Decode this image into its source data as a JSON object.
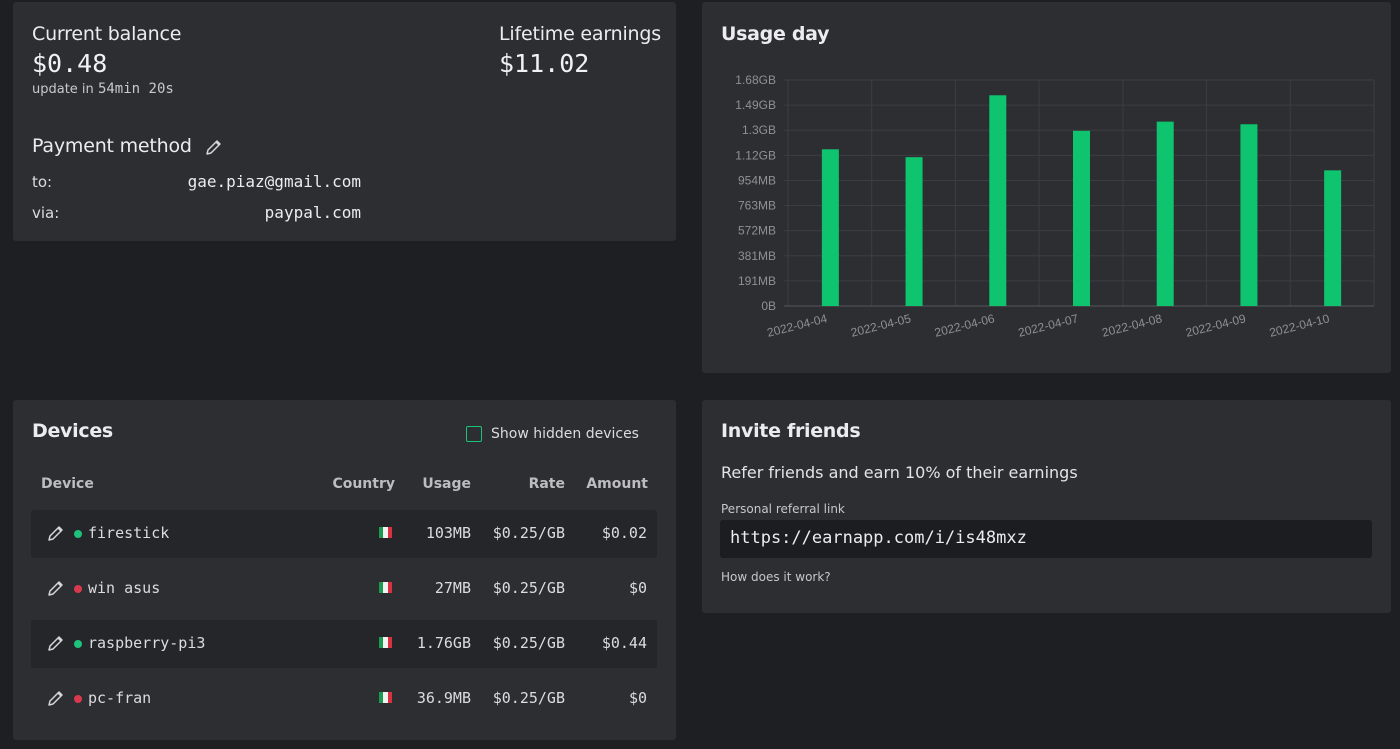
{
  "balance": {
    "current_label": "Current balance",
    "current_value": "$0.48",
    "update_prefix": "update in",
    "update_time": "54min 20s",
    "lifetime_label": "Lifetime earnings",
    "lifetime_value": "$11.02",
    "payment_title": "Payment method",
    "to_label": "to:",
    "to_value": "gae.piaz@gmail.com",
    "via_label": "via:",
    "via_value": "paypal.com"
  },
  "usage": {
    "title": "Usage day"
  },
  "chart_data": {
    "type": "bar",
    "title": "Usage day",
    "xlabel": "",
    "ylabel": "",
    "categories": [
      "2022-04-04",
      "2022-04-05",
      "2022-04-06",
      "2022-04-07",
      "2022-04-08",
      "2022-04-09",
      "2022-04-10"
    ],
    "values_mb": [
      1190,
      1130,
      1600,
      1330,
      1400,
      1380,
      1030
    ],
    "y_ticks": [
      "0B",
      "191MB",
      "381MB",
      "572MB",
      "763MB",
      "954MB",
      "1.12GB",
      "1.3GB",
      "1.49GB",
      "1.68GB"
    ],
    "ylim_mb": [
      0,
      1716
    ],
    "grid": true,
    "bar_color": "#0ec46e"
  },
  "devices": {
    "title": "Devices",
    "show_hidden_label": "Show hidden devices",
    "columns": {
      "device": "Device",
      "country": "Country",
      "usage": "Usage",
      "rate": "Rate",
      "amount": "Amount"
    },
    "rows": [
      {
        "name": "firestick",
        "status": "online",
        "usage": "103MB",
        "rate": "$0.25/GB",
        "amount": "$0.02"
      },
      {
        "name": "win asus",
        "status": "offline",
        "usage": "27MB",
        "rate": "$0.25/GB",
        "amount": "$0"
      },
      {
        "name": "raspberry-pi3",
        "status": "online",
        "usage": "1.76GB",
        "rate": "$0.25/GB",
        "amount": "$0.44"
      },
      {
        "name": "pc-fran",
        "status": "offline",
        "usage": "36.9MB",
        "rate": "$0.25/GB",
        "amount": "$0"
      }
    ],
    "status_colors": {
      "online": "#1fc27a",
      "offline": "#d9394f"
    }
  },
  "invite": {
    "title": "Invite friends",
    "subtitle": "Refer friends and earn 10% of their earnings",
    "link_label": "Personal referral link",
    "link_value": "https://earnapp.com/i/is48mxz",
    "how_label": "How does it work?"
  }
}
